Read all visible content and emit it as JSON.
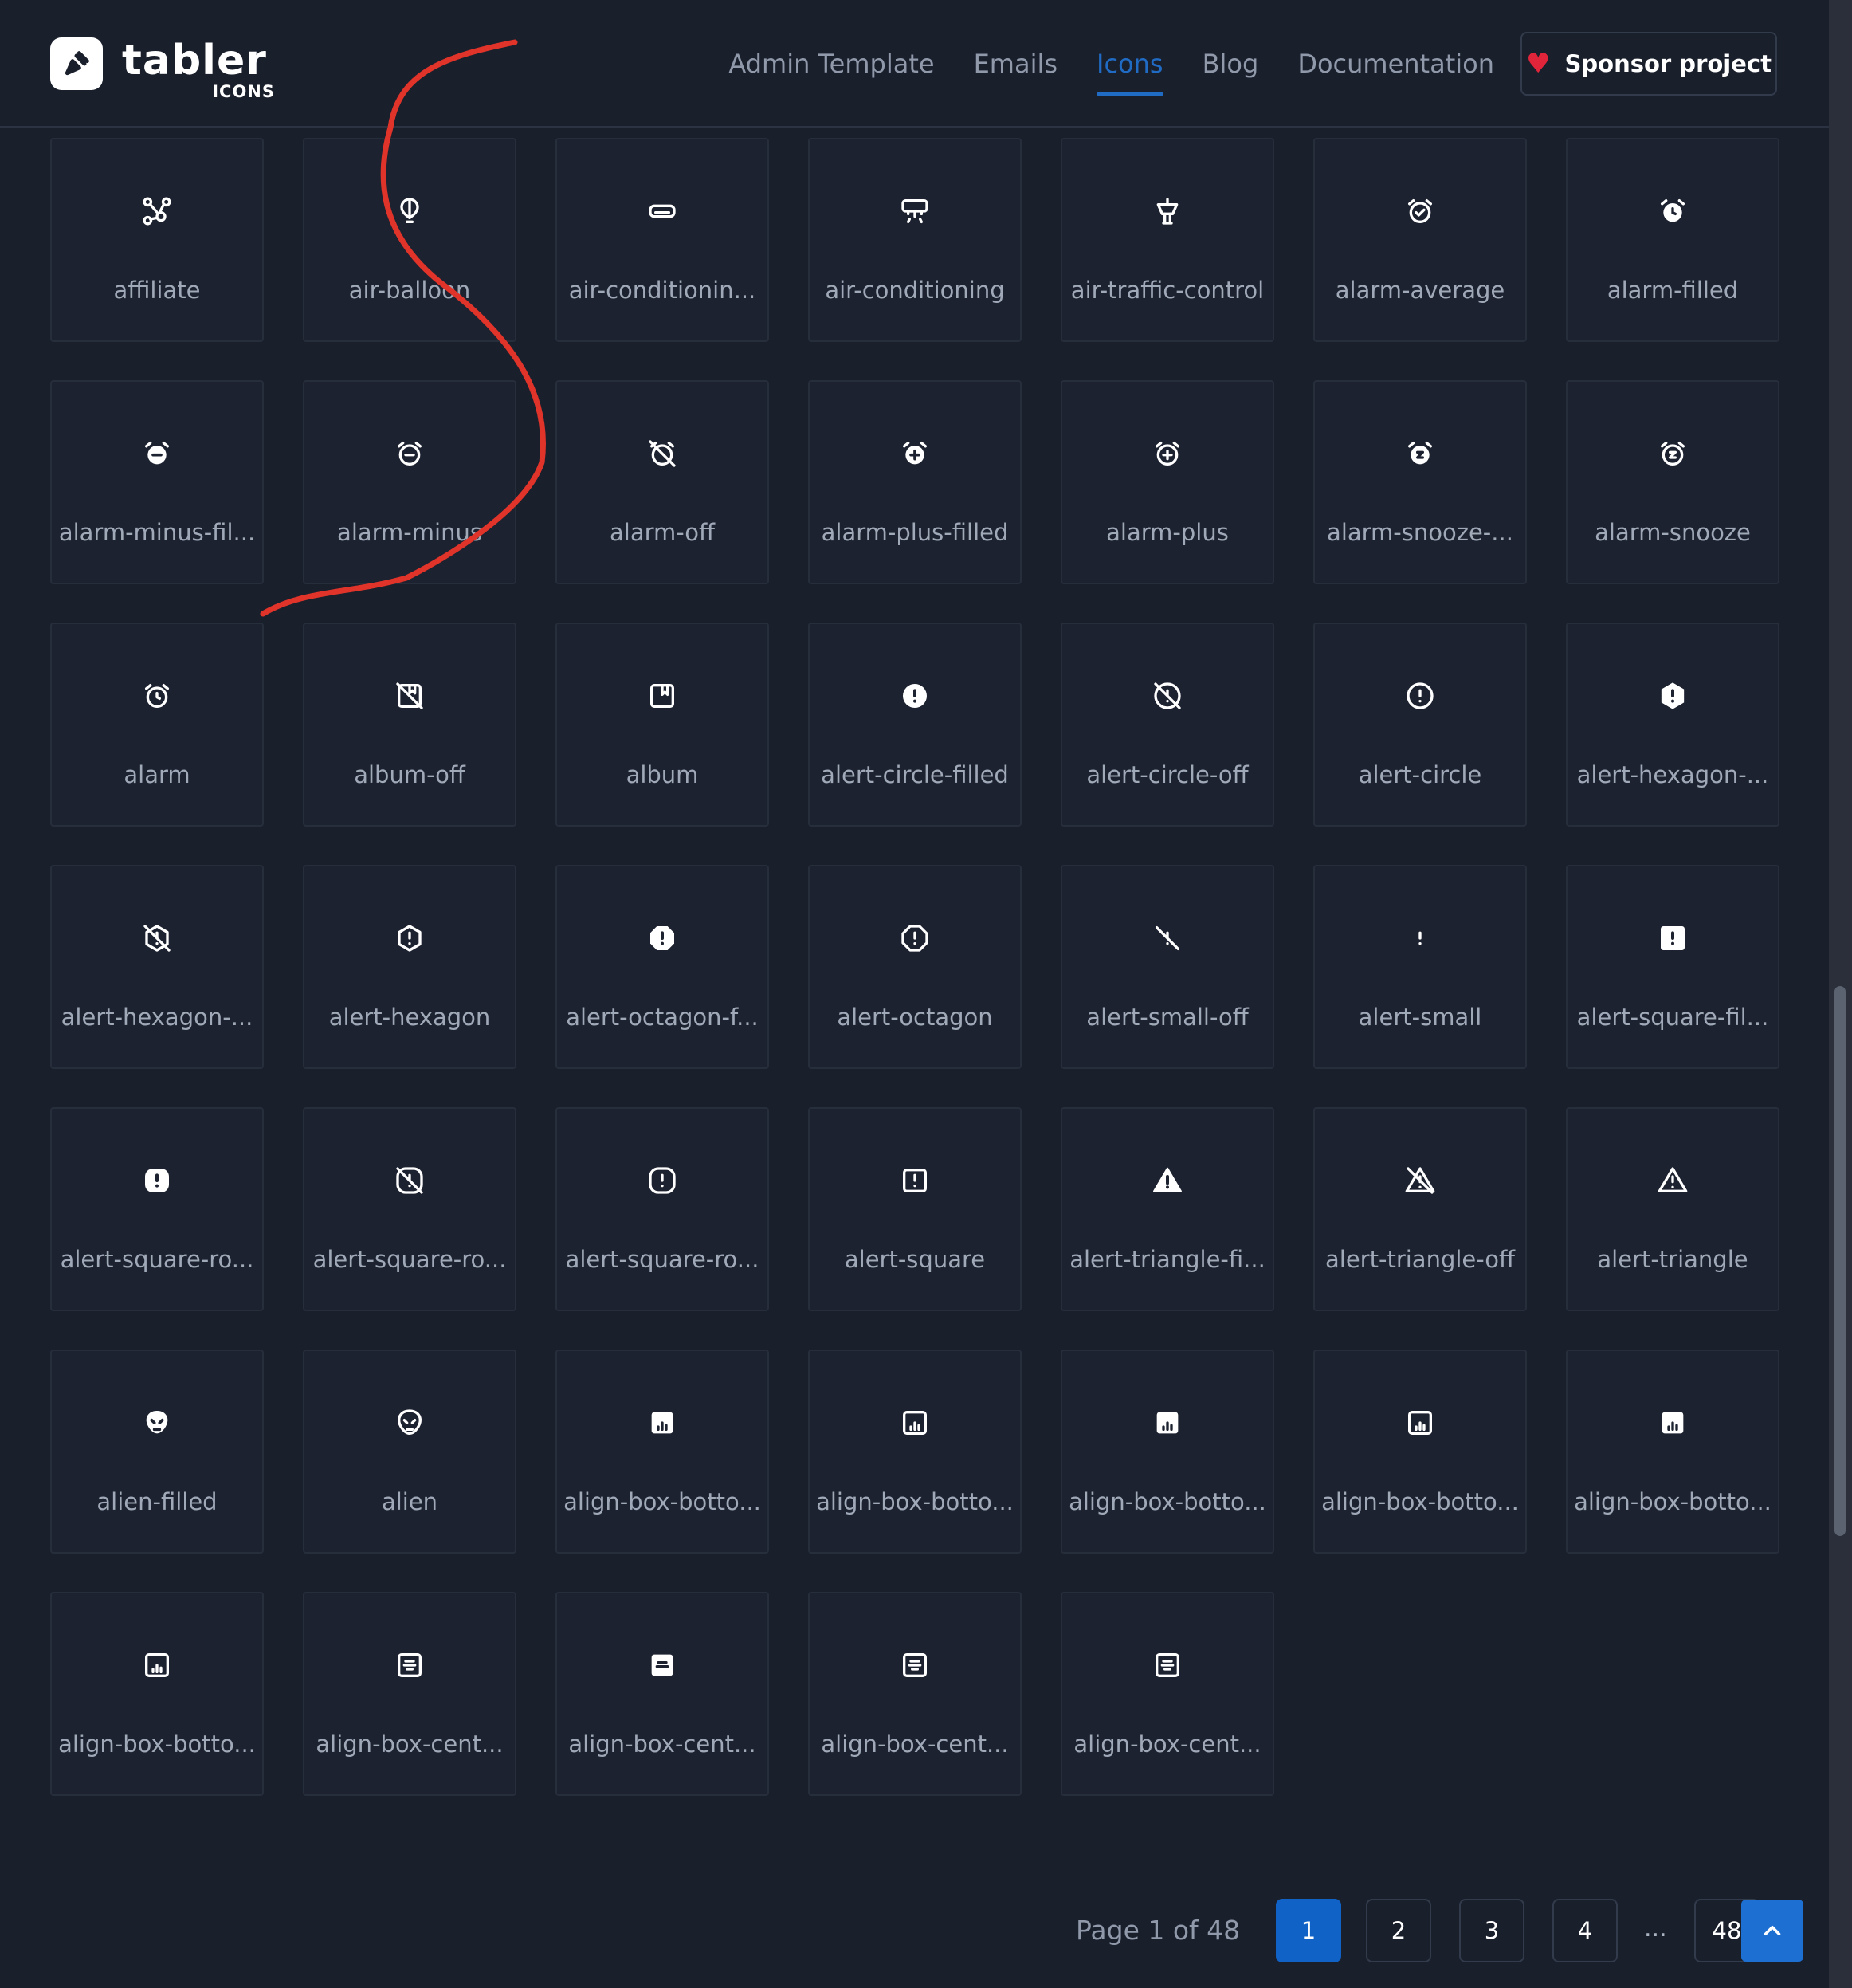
{
  "brand": {
    "name": "tabler",
    "sub": "ICONS"
  },
  "nav": [
    {
      "label": "Admin Template",
      "active": false
    },
    {
      "label": "Emails",
      "active": false
    },
    {
      "label": "Icons",
      "active": true
    },
    {
      "label": "Blog",
      "active": false
    },
    {
      "label": "Documentation",
      "active": false
    }
  ],
  "sponsor": {
    "label": "Sponsor project",
    "icon": "heart-icon"
  },
  "icons": [
    {
      "label": "affiliate",
      "icon": "affiliate"
    },
    {
      "label": "air-balloon",
      "icon": "air-balloon"
    },
    {
      "label": "air-conditionin...",
      "icon": "ac-off"
    },
    {
      "label": "air-conditioning",
      "icon": "ac"
    },
    {
      "label": "air-traffic-control",
      "icon": "atc"
    },
    {
      "label": "alarm-average",
      "icon": "alarm-average"
    },
    {
      "label": "alarm-filled",
      "icon": "alarm-filled"
    },
    {
      "label": "alarm-minus-fil...",
      "icon": "alarm-minus-filled"
    },
    {
      "label": "alarm-minus",
      "icon": "alarm-minus"
    },
    {
      "label": "alarm-off",
      "icon": "alarm-off"
    },
    {
      "label": "alarm-plus-filled",
      "icon": "alarm-plus-filled"
    },
    {
      "label": "alarm-plus",
      "icon": "alarm-plus"
    },
    {
      "label": "alarm-snooze-...",
      "icon": "alarm-snooze-filled"
    },
    {
      "label": "alarm-snooze",
      "icon": "alarm-snooze"
    },
    {
      "label": "alarm",
      "icon": "alarm"
    },
    {
      "label": "album-off",
      "icon": "album-off"
    },
    {
      "label": "album",
      "icon": "album"
    },
    {
      "label": "alert-circle-filled",
      "icon": "alert-circle-filled"
    },
    {
      "label": "alert-circle-off",
      "icon": "alert-circle-off"
    },
    {
      "label": "alert-circle",
      "icon": "alert-circle"
    },
    {
      "label": "alert-hexagon-...",
      "icon": "alert-hexagon-filled"
    },
    {
      "label": "alert-hexagon-...",
      "icon": "alert-hexagon-off"
    },
    {
      "label": "alert-hexagon",
      "icon": "alert-hexagon"
    },
    {
      "label": "alert-octagon-f...",
      "icon": "alert-octagon-filled"
    },
    {
      "label": "alert-octagon",
      "icon": "alert-octagon"
    },
    {
      "label": "alert-small-off",
      "icon": "alert-small-off"
    },
    {
      "label": "alert-small",
      "icon": "alert-small"
    },
    {
      "label": "alert-square-fil...",
      "icon": "alert-square-filled"
    },
    {
      "label": "alert-square-ro...",
      "icon": "alert-square-rounded-filled"
    },
    {
      "label": "alert-square-ro...",
      "icon": "alert-square-rounded-off"
    },
    {
      "label": "alert-square-ro...",
      "icon": "alert-square-rounded"
    },
    {
      "label": "alert-square",
      "icon": "alert-square"
    },
    {
      "label": "alert-triangle-fi...",
      "icon": "alert-triangle-filled"
    },
    {
      "label": "alert-triangle-off",
      "icon": "alert-triangle-off"
    },
    {
      "label": "alert-triangle",
      "icon": "alert-triangle"
    },
    {
      "label": "alien-filled",
      "icon": "alien-filled"
    },
    {
      "label": "alien",
      "icon": "alien"
    },
    {
      "label": "align-box-botto...",
      "icon": "align-bottom-filled"
    },
    {
      "label": "align-box-botto...",
      "icon": "align-bottom"
    },
    {
      "label": "align-box-botto...",
      "icon": "align-bottom-filled"
    },
    {
      "label": "align-box-botto...",
      "icon": "align-bottom"
    },
    {
      "label": "align-box-botto...",
      "icon": "align-bottom-filled"
    },
    {
      "label": "align-box-botto...",
      "icon": "align-bottom"
    },
    {
      "label": "align-box-cent...",
      "icon": "align-center"
    },
    {
      "label": "align-box-cent...",
      "icon": "align-center-filled"
    },
    {
      "label": "align-box-cent...",
      "icon": "align-center"
    },
    {
      "label": "align-box-cent...",
      "icon": "align-center"
    }
  ],
  "pagination": {
    "info": "Page 1 of 48",
    "pages": [
      "1",
      "2",
      "3",
      "4"
    ],
    "dots": "...",
    "last": "48",
    "current": "1"
  },
  "colors": {
    "background": "#1a1f2c",
    "accent": "#206bc4",
    "annotation": "#e0342a"
  }
}
